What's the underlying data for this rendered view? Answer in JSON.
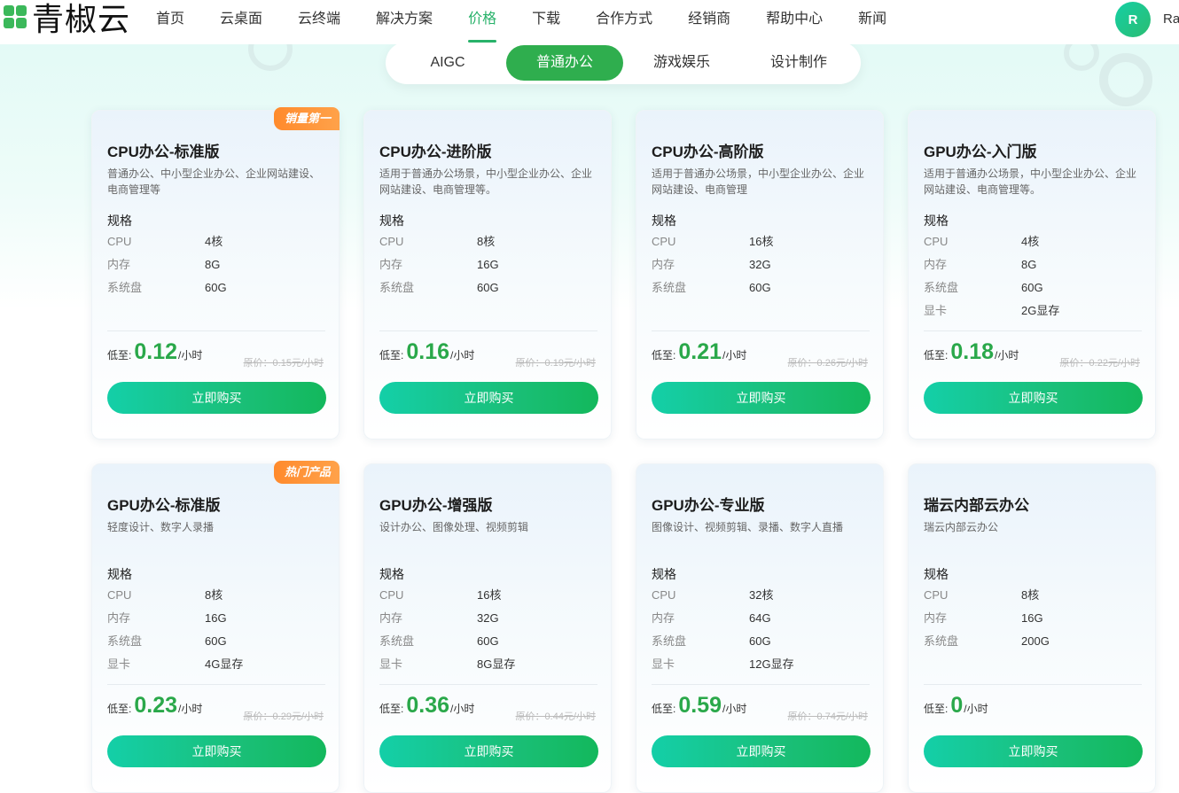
{
  "header": {
    "logo_text": "青椒云",
    "nav": [
      "首页",
      "云桌面",
      "云终端",
      "解决方案",
      "价格",
      "下载",
      "合作方式",
      "经销商",
      "帮助中心",
      "新闻"
    ],
    "active_nav_index": 4,
    "avatar_letter": "R",
    "username": "Ra"
  },
  "tabs": {
    "items": [
      "AIGC",
      "普通办公",
      "游戏娱乐",
      "设计制作"
    ],
    "active_index": 1
  },
  "labels": {
    "spec_head": "规格",
    "price_pre": "低至:",
    "price_unit": "/小时",
    "buy": "立即购买"
  },
  "cards": [
    {
      "title": "CPU办公-标准版",
      "desc": "普通办公、中小型企业办公、企业网站建设、电商管理等",
      "badge": "销量第一",
      "specs": [
        [
          "CPU",
          "4核"
        ],
        [
          "内存",
          "8G"
        ],
        [
          "系统盘",
          "60G"
        ]
      ],
      "price": "0.12",
      "original": "原价：0.15元/小时"
    },
    {
      "title": "CPU办公-进阶版",
      "desc": "适用于普通办公场景，中小型企业办公、企业网站建设、电商管理等。",
      "badge": "",
      "specs": [
        [
          "CPU",
          "8核"
        ],
        [
          "内存",
          "16G"
        ],
        [
          "系统盘",
          "60G"
        ]
      ],
      "price": "0.16",
      "original": "原价：0.19元/小时"
    },
    {
      "title": "CPU办公-高阶版",
      "desc": "适用于普通办公场景，中小型企业办公、企业网站建设、电商管理",
      "badge": "",
      "specs": [
        [
          "CPU",
          "16核"
        ],
        [
          "内存",
          "32G"
        ],
        [
          "系统盘",
          "60G"
        ]
      ],
      "price": "0.21",
      "original": "原价：0.26元/小时"
    },
    {
      "title": "GPU办公-入门版",
      "desc": "适用于普通办公场景，中小型企业办公、企业网站建设、电商管理等。",
      "badge": "",
      "specs": [
        [
          "CPU",
          "4核"
        ],
        [
          "内存",
          "8G"
        ],
        [
          "系统盘",
          "60G"
        ],
        [
          "显卡",
          "2G显存"
        ]
      ],
      "price": "0.18",
      "original": "原价：0.22元/小时"
    },
    {
      "title": "GPU办公-标准版",
      "desc": "轻度设计、数字人录播",
      "badge": "热门产品",
      "specs": [
        [
          "CPU",
          "8核"
        ],
        [
          "内存",
          "16G"
        ],
        [
          "系统盘",
          "60G"
        ],
        [
          "显卡",
          "4G显存"
        ]
      ],
      "price": "0.23",
      "original": "原价：0.29元/小时"
    },
    {
      "title": "GPU办公-增强版",
      "desc": "设计办公、图像处理、视频剪辑",
      "badge": "",
      "specs": [
        [
          "CPU",
          "16核"
        ],
        [
          "内存",
          "32G"
        ],
        [
          "系统盘",
          "60G"
        ],
        [
          "显卡",
          "8G显存"
        ]
      ],
      "price": "0.36",
      "original": "原价：0.44元/小时"
    },
    {
      "title": "GPU办公-专业版",
      "desc": "图像设计、视频剪辑、录播、数字人直播",
      "badge": "",
      "specs": [
        [
          "CPU",
          "32核"
        ],
        [
          "内存",
          "64G"
        ],
        [
          "系统盘",
          "60G"
        ],
        [
          "显卡",
          "12G显存"
        ]
      ],
      "price": "0.59",
      "original": "原价：0.74元/小时"
    },
    {
      "title": "瑞云内部云办公",
      "desc": "瑞云内部云办公",
      "badge": "",
      "specs": [
        [
          "CPU",
          "8核"
        ],
        [
          "内存",
          "16G"
        ],
        [
          "系统盘",
          "200G"
        ]
      ],
      "price": "0",
      "original": ""
    }
  ]
}
